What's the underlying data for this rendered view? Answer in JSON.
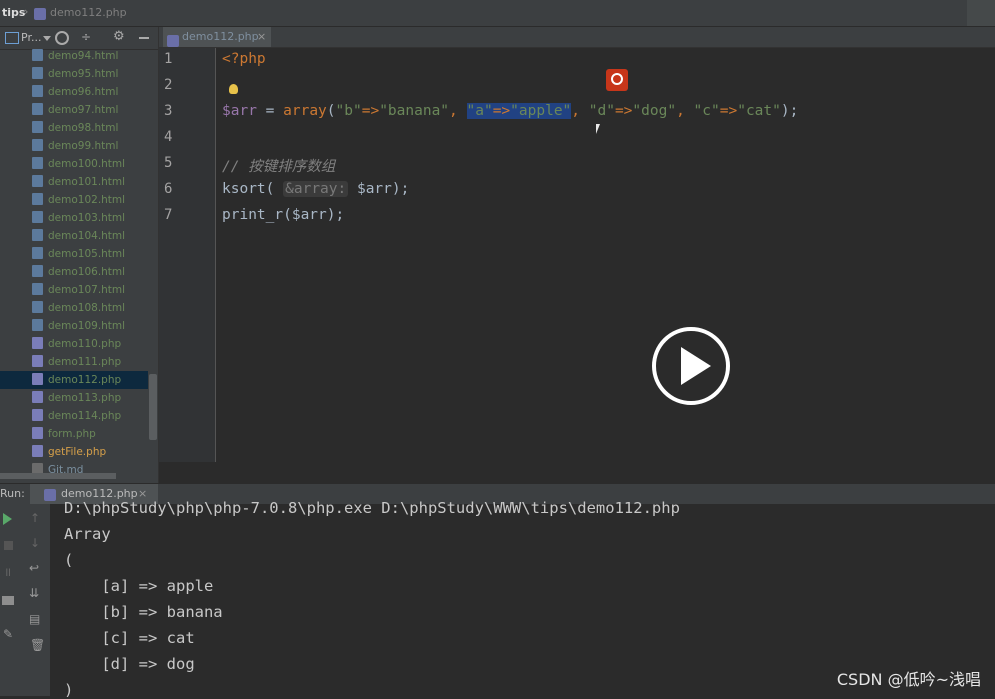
{
  "breadcrumb": {
    "root": "tips",
    "sep": "›",
    "file": "demo112.php"
  },
  "project_panel": {
    "title": "Pr...",
    "items": [
      {
        "label": "demo94.html",
        "kind": "html"
      },
      {
        "label": "demo95.html",
        "kind": "html"
      },
      {
        "label": "demo96.html",
        "kind": "html"
      },
      {
        "label": "demo97.html",
        "kind": "html"
      },
      {
        "label": "demo98.html",
        "kind": "html"
      },
      {
        "label": "demo99.html",
        "kind": "html"
      },
      {
        "label": "demo100.html",
        "kind": "html"
      },
      {
        "label": "demo101.html",
        "kind": "html"
      },
      {
        "label": "demo102.html",
        "kind": "html"
      },
      {
        "label": "demo103.html",
        "kind": "html"
      },
      {
        "label": "demo104.html",
        "kind": "html"
      },
      {
        "label": "demo105.html",
        "kind": "html"
      },
      {
        "label": "demo106.html",
        "kind": "html"
      },
      {
        "label": "demo107.html",
        "kind": "html"
      },
      {
        "label": "demo108.html",
        "kind": "html"
      },
      {
        "label": "demo109.html",
        "kind": "html"
      },
      {
        "label": "demo110.php",
        "kind": "php"
      },
      {
        "label": "demo111.php",
        "kind": "php"
      },
      {
        "label": "demo112.php",
        "kind": "php"
      },
      {
        "label": "demo113.php",
        "kind": "php"
      },
      {
        "label": "demo114.php",
        "kind": "php"
      },
      {
        "label": "form.php",
        "kind": "php"
      },
      {
        "label": "getFile.php",
        "kind": "php"
      },
      {
        "label": "Git.md",
        "kind": "md"
      }
    ]
  },
  "editor": {
    "tab_label": "demo112.php",
    "tab_close": "×",
    "line_numbers": [
      "1",
      "2",
      "3",
      "4",
      "5",
      "6",
      "7"
    ],
    "code": {
      "open_tag": "<?php",
      "l3_var": "$arr",
      "l3_eq": " = ",
      "l3_fn": "array",
      "l3_p1": "(",
      "l3_s1": "\"b\"",
      "l3_op1": "=>",
      "l3_s2": "\"banana\"",
      "l3_c1": ", ",
      "l3_s3": "\"a\"",
      "l3_op2": "=>",
      "l3_s4": "\"apple\"",
      "l3_c2": ", ",
      "l3_s5": "\"d\"",
      "l3_op3": "=>",
      "l3_s6": "\"dog\"",
      "l3_c3": ", ",
      "l3_s7": "\"c\"",
      "l3_op4": "=>",
      "l3_s8": "\"cat\"",
      "l3_end": ");",
      "comment": "// 按键排序数组",
      "l6_fn": "ksort",
      "l6_p": "( ",
      "l6_hint": "&array:",
      "l6_var": " $arr",
      "l6_end": ");",
      "l7_fn": "print_r",
      "l7_p": "(",
      "l7_var": "$arr",
      "l7_end": ");"
    }
  },
  "run": {
    "label": "Run:",
    "tab_label": "demo112.php",
    "tab_close": "×",
    "output": [
      "D:\\phpStudy\\php\\php-7.0.8\\php.exe D:\\phpStudy\\WWW\\tips\\demo112.php",
      "Array",
      "(",
      "    [a] => apple",
      "    [b] => banana",
      "    [c] => cat",
      "    [d] => dog",
      ")"
    ]
  },
  "watermark": "CSDN @低吟~浅唱",
  "colors": {
    "accent": "#214283",
    "keyword": "#cc7832",
    "string": "#6a8759",
    "variable": "#9876aa",
    "function": "#ffc66d"
  }
}
